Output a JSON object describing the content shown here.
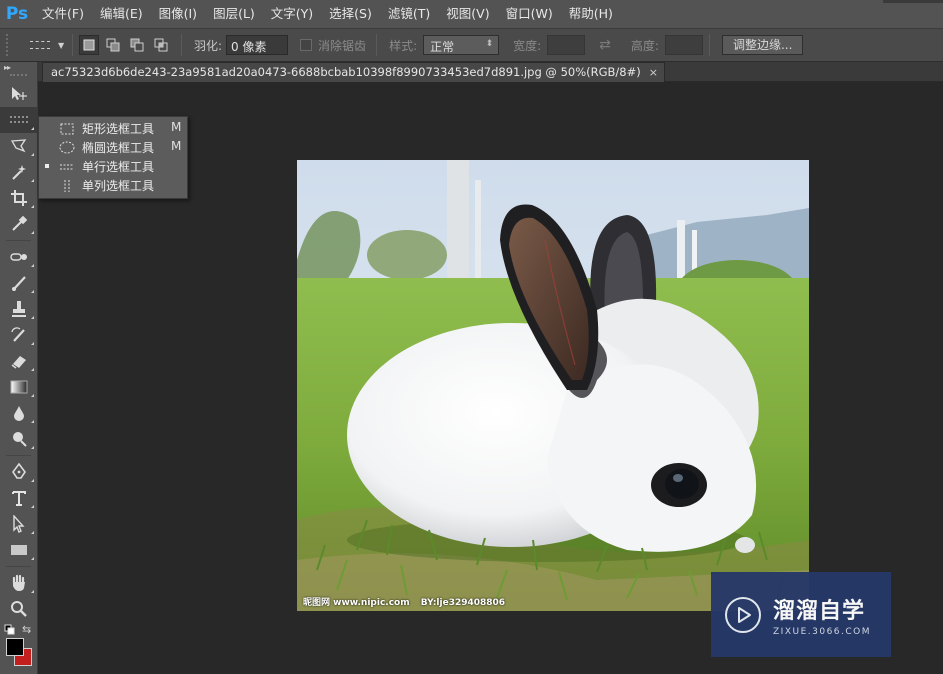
{
  "app": {
    "logo": "Ps",
    "accent": "#31a8ff"
  },
  "menu": [
    "文件(F)",
    "编辑(E)",
    "图像(I)",
    "图层(L)",
    "文字(Y)",
    "选择(S)",
    "滤镜(T)",
    "视图(V)",
    "窗口(W)",
    "帮助(H)"
  ],
  "options": {
    "feather_label": "羽化:",
    "feather_value": "0 像素",
    "antialias_label": "消除锯齿",
    "style_label": "样式:",
    "style_value": "正常",
    "width_label": "宽度:",
    "height_label": "高度:",
    "refine_button": "调整边缘..."
  },
  "document": {
    "tab_title": "ac75323d6b6de243-23a9581ad20a0473-6688bcbab10398f8990733453ed7d891.jpg @ 50%(RGB/8#)",
    "close_glyph": "×"
  },
  "flyout": {
    "items": [
      {
        "label": "矩形选框工具",
        "shortcut": "M",
        "icon": "rect-marquee-icon",
        "selected": false
      },
      {
        "label": "椭圆选框工具",
        "shortcut": "M",
        "icon": "ellipse-marquee-icon",
        "selected": false
      },
      {
        "label": "单行选框工具",
        "shortcut": "",
        "icon": "single-row-marquee-icon",
        "selected": true
      },
      {
        "label": "单列选框工具",
        "shortcut": "",
        "icon": "single-column-marquee-icon",
        "selected": false
      }
    ]
  },
  "artwork": {
    "watermark_site": "昵图网 www.nipic.com",
    "watermark_id": "BY:lje329408806"
  },
  "colors": {
    "foreground": "#000000",
    "background": "#c41f1f"
  },
  "badge": {
    "title": "溜溜自学",
    "subtitle": "ZIXUE.3066.COM",
    "color": "#253867"
  }
}
